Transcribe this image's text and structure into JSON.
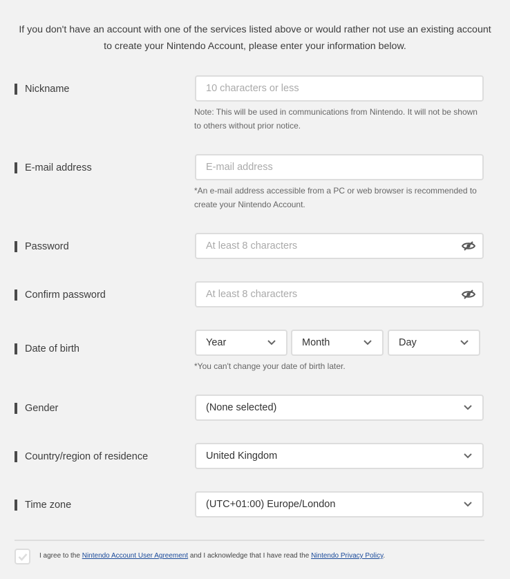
{
  "intro": {
    "line1": "If you don't have an account with one of the services listed above or would rather not use an existing account",
    "line2": "to create your Nintendo Account, please enter your information below."
  },
  "nickname": {
    "label": "Nickname",
    "placeholder": "10 characters or less",
    "note_line1": "Note: This will be used in communications from Nintendo. It will not be shown",
    "note_line2": "to others without prior notice."
  },
  "email": {
    "label": "E-mail address",
    "placeholder": "E-mail address",
    "note_line1": "*An e-mail address accessible from a PC or web browser is recommended to",
    "note_line2": "create your Nintendo Account."
  },
  "password": {
    "label": "Password",
    "placeholder": "At least 8 characters",
    "icon": "eye-hidden-icon"
  },
  "confirm_password": {
    "label": "Confirm password",
    "placeholder": "At least 8 characters",
    "icon": "eye-hidden-icon"
  },
  "dob": {
    "label": "Date of birth",
    "year": "Year",
    "month": "Month",
    "day": "Day",
    "note": "*You can't change your date of birth later."
  },
  "gender": {
    "label": "Gender",
    "value": "(None selected)"
  },
  "country": {
    "label": "Country/region of residence",
    "value": "United Kingdom"
  },
  "timezone": {
    "label": "Time zone",
    "value": "(UTC+01:00) Europe/London"
  },
  "agreement": {
    "prefix": "I agree to the ",
    "link1": "Nintendo Account User Agreement",
    "middle": " and I acknowledge that I have read the ",
    "link2": "Nintendo Privacy Policy",
    "suffix": "."
  },
  "colors": {
    "background": "#f2f2f2",
    "border": "#dddddd",
    "link": "#1a4a9a"
  }
}
